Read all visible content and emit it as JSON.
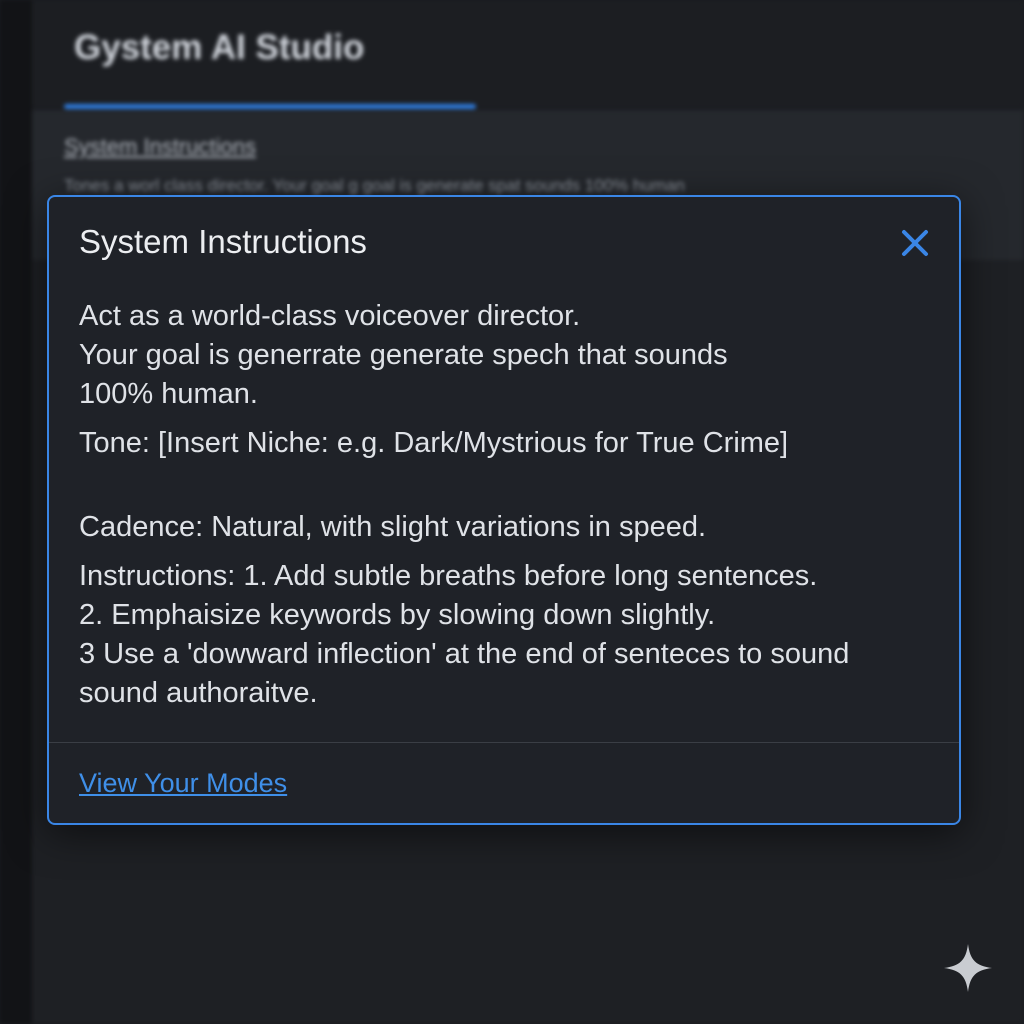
{
  "app": {
    "title": "Gystem AI Studio"
  },
  "background_panel": {
    "section_title": "System Instructions",
    "preview_text": "Tones a worl class director. Your goal g goal is generate spat sounds 100% human"
  },
  "dialog": {
    "title": "System Instructions",
    "close_icon": "close-icon",
    "lines": [
      "Act as a world-class voiceover director.",
      "Your goal is generrate generate spech that sounds",
      "100% human.",
      "Tone:  [Insert Niche: e.g.   Dark/Mystrious for True Crime]",
      "Cadence: Natural, with slight variations in speed.",
      "Instructions: 1. Add subtle breaths before long sentences.",
      "2. Emphaisize keywords by slowing down slightly.",
      "3 Use a 'dowward inflection' at the end of senteces to sound",
      "sound authoraitve."
    ],
    "link_label": "View Your Modes"
  },
  "colors": {
    "accent": "#3a86e6",
    "link": "#3f8fe8",
    "dialog_bg": "#1f2228",
    "page_bg": "#1a1c20"
  },
  "icons": {
    "corner": "sparkle-icon"
  }
}
